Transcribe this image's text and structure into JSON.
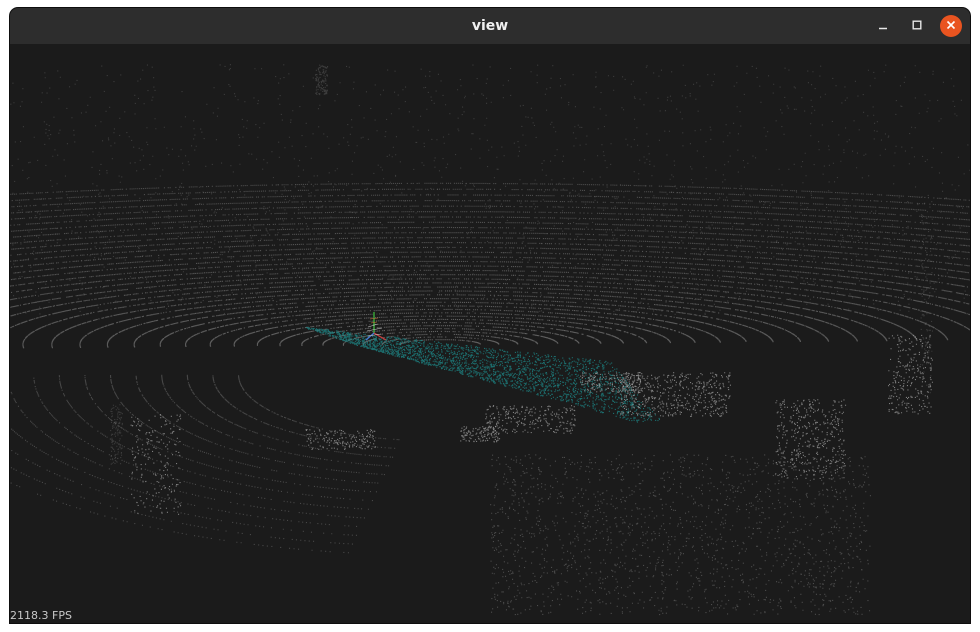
{
  "window": {
    "title": "view"
  },
  "titlebar_buttons": {
    "minimize_icon": "minimize-icon",
    "maximize_icon": "maximize-icon",
    "close_icon": "close-icon"
  },
  "viewer": {
    "fps_label": "2118.3 FPS"
  },
  "colors": {
    "title_bar": "#2d2d2d",
    "canvas_bg": "#1b1b1b",
    "close_button": "#e95420",
    "point_gray": "#8a8a8a",
    "point_teal": "#1e8a8a"
  }
}
